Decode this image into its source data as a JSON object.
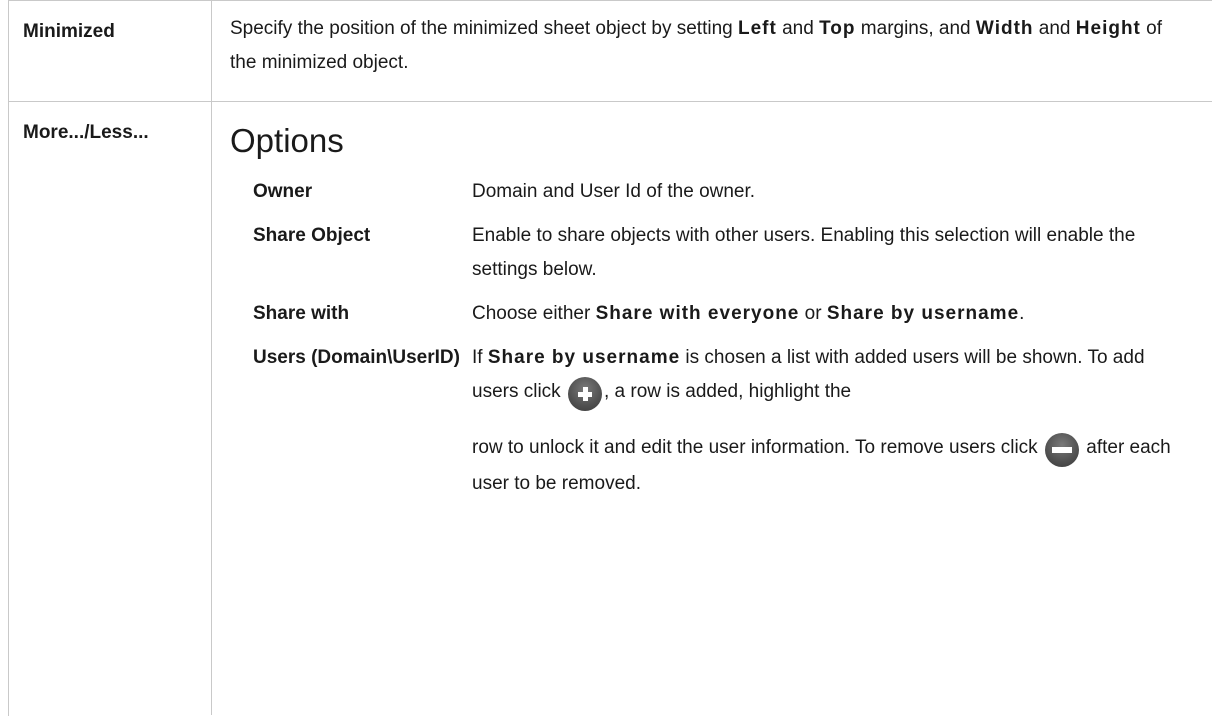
{
  "rows": {
    "minimized": {
      "label": "Minimized",
      "text_1": "Specify the position of the minimized sheet object by setting ",
      "kw_left": "Left",
      "text_2": " and ",
      "kw_top": "Top",
      "text_3": " margins, and ",
      "kw_width": "Width",
      "text_4": " and ",
      "kw_height": "Height",
      "text_5": " of the minimized object."
    },
    "more_less": {
      "label": "More.../Less...",
      "heading": "Options",
      "options": {
        "owner": {
          "label": "Owner",
          "text": "Domain and User Id of the owner."
        },
        "share_object": {
          "label": "Share Object",
          "text": "Enable to share objects with other users. Enabling this selection will enable the settings below."
        },
        "share_with": {
          "label": "Share with",
          "text_1": "Choose either ",
          "kw_everyone": "Share with everyone",
          "text_2": " or ",
          "kw_username": "Share by username",
          "text_3": "."
        },
        "users": {
          "label": "Users (Domain\\UserID)",
          "text_1": "If ",
          "kw_username": "Share by username",
          "text_2": " is chosen a list with added users will be shown. To add users click ",
          "plus_icon": "plus-circle-icon",
          "text_3": ", a row is added, highlight the",
          "text_4": "row to unlock it and edit the user information. To remove users click ",
          "minus_icon": "minus-circle-icon",
          "text_5": " after each user to be removed."
        }
      }
    }
  }
}
